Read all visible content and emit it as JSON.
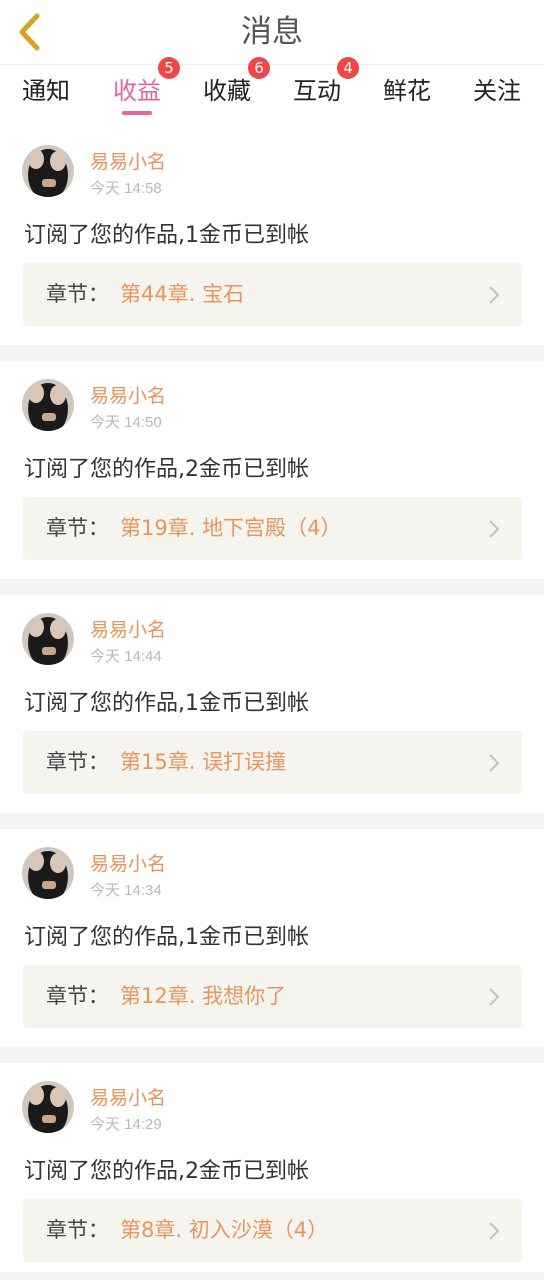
{
  "header": {
    "title": "消息"
  },
  "tabs": [
    {
      "label": "通知",
      "badge": null
    },
    {
      "label": "收益",
      "badge": "5",
      "active": true
    },
    {
      "label": "收藏",
      "badge": "6"
    },
    {
      "label": "互动",
      "badge": "4"
    },
    {
      "label": "鲜花",
      "badge": null
    },
    {
      "label": "关注",
      "badge": null
    }
  ],
  "colors": {
    "accent": "#e8649c",
    "badge": "#f04646",
    "username": "#e8935a",
    "chapter": "#ea955d"
  },
  "messages": [
    {
      "user": "易易小名",
      "time": "今天 14:58",
      "text": "订阅了您的作品,1金币已到帐",
      "chapter_label": "章节：",
      "chapter": "第44章. 宝石"
    },
    {
      "user": "易易小名",
      "time": "今天 14:50",
      "text": "订阅了您的作品,2金币已到帐",
      "chapter_label": "章节：",
      "chapter": "第19章. 地下宫殿（4）"
    },
    {
      "user": "易易小名",
      "time": "今天 14:44",
      "text": "订阅了您的作品,1金币已到帐",
      "chapter_label": "章节：",
      "chapter": "第15章. 误打误撞"
    },
    {
      "user": "易易小名",
      "time": "今天 14:34",
      "text": "订阅了您的作品,1金币已到帐",
      "chapter_label": "章节：",
      "chapter": "第12章. 我想你了"
    },
    {
      "user": "易易小名",
      "time": "今天 14:29",
      "text": "订阅了您的作品,2金币已到帐",
      "chapter_label": "章节：",
      "chapter": "第8章. 初入沙漠（4）"
    }
  ]
}
